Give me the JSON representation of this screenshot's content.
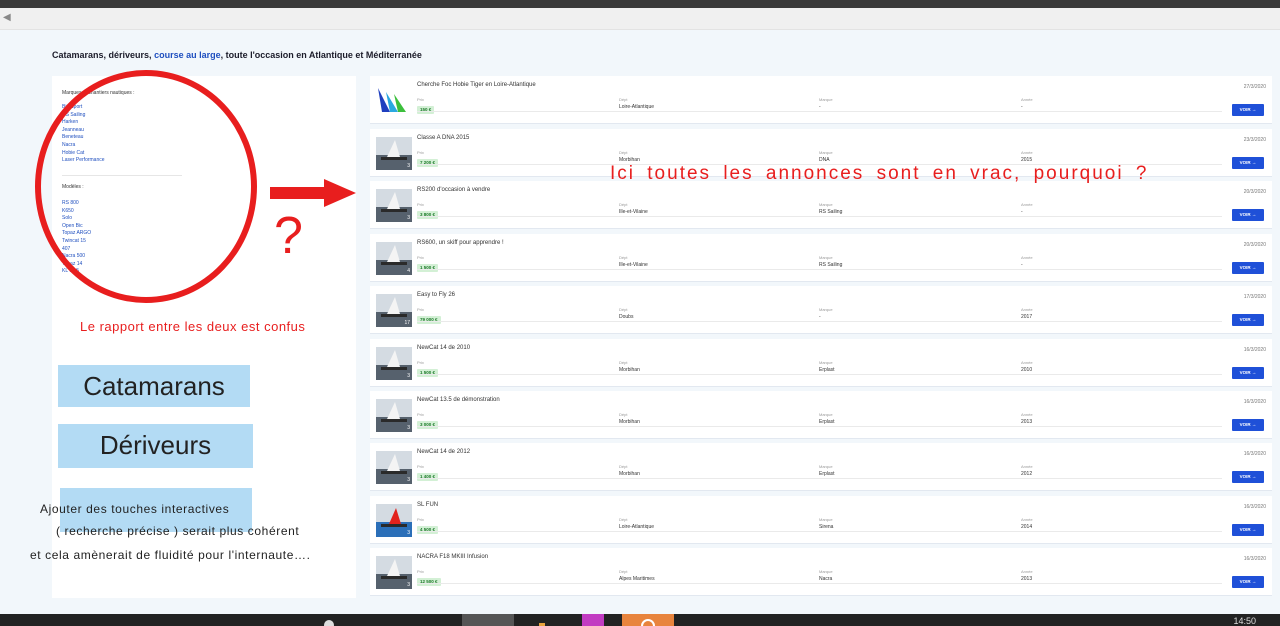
{
  "page": {
    "heading_part1": "Catamarans, dériveurs, ",
    "heading_link": "course au large",
    "heading_part2": ", toute l'occasion en Atlantique et Méditerranée"
  },
  "sidebar": {
    "brands_heading": "Marques et chantiers nautiques :",
    "brands": [
      "Bic Sport",
      "RS Sailing",
      "Harken",
      "Jeanneau",
      "Beneteau",
      "Nacra",
      "Hobie Cat",
      "Laser Performance"
    ],
    "models_heading": "Modèles :",
    "models": [
      "RS 800",
      "K650",
      "Solo",
      "Open Bic",
      "Topaz ARGO",
      "Twincat 15",
      "407",
      "Nacra 500",
      "Topaz 14",
      "KL 15.5"
    ]
  },
  "columns": {
    "price": "Prix",
    "dept": "Dépt",
    "brand": "Marque",
    "year": "Année"
  },
  "voir_label": "VOIR →",
  "listings": [
    {
      "title": "Cherche Foc Hobie Tiger en Loire-Atlantique",
      "price": "150 €",
      "dept": "Loire-Atlantique",
      "brand": "-",
      "year": "-",
      "date": "27/3/2020",
      "photos": ""
    },
    {
      "title": "Classe A DNA 2015",
      "price": "7 200 €",
      "dept": "Morbihan",
      "brand": "DNA",
      "year": "2015",
      "date": "23/3/2020",
      "photos": "3"
    },
    {
      "title": "RS200 d'occasion à vendre",
      "price": "3 800 €",
      "dept": "Ille-et-Vilaine",
      "brand": "RS Sailing",
      "year": "-",
      "date": "20/3/2020",
      "photos": "3"
    },
    {
      "title": "RS600, un skiff pour apprendre !",
      "price": "1 500 €",
      "dept": "Ille-et-Vilaine",
      "brand": "RS Sailing",
      "year": "-",
      "date": "20/3/2020",
      "photos": "4"
    },
    {
      "title": "Easy to Fly 26",
      "price": "79 000 €",
      "dept": "Doubs",
      "brand": "-",
      "year": "2017",
      "date": "17/3/2020",
      "photos": "17"
    },
    {
      "title": "NewCat 14 de 2010",
      "price": "1 500 €",
      "dept": "Morbihan",
      "brand": "Erplast",
      "year": "2010",
      "date": "16/3/2020",
      "photos": "3"
    },
    {
      "title": "NewCat 13.5 de démonstration",
      "price": "3 000 €",
      "dept": "Morbihan",
      "brand": "Erplast",
      "year": "2013",
      "date": "16/3/2020",
      "photos": "3"
    },
    {
      "title": "NewCat 14 de 2012",
      "price": "1 400 €",
      "dept": "Morbihan",
      "brand": "Erplast",
      "year": "2012",
      "date": "16/3/2020",
      "photos": "3"
    },
    {
      "title": "SL FUN",
      "price": "4 500 €",
      "dept": "Loire-Atlantique",
      "brand": "Sirena",
      "year": "2014",
      "date": "16/3/2020",
      "photos": "3"
    },
    {
      "title": "NACRA F18 MKIII Infusion",
      "price": "12 500 €",
      "dept": "Alpes Maritimes",
      "brand": "Nacra",
      "year": "2013",
      "date": "16/3/2020",
      "photos": "3"
    }
  ],
  "annotations": {
    "question_mark": "?",
    "right_note": "Ici toutes les annonces sont en vrac, pourquoi ?",
    "confus_note": "Le rapport entre les deux est confus",
    "button_catamarans": "Catamarans",
    "button_deriveurs": "Dériveurs",
    "suggestion_line1": "Ajouter des touches interactives",
    "suggestion_line2": "( recherche précise ) serait plus cohérent",
    "suggestion_line3": "et cela amènerait de fluidité pour l'internaute…."
  },
  "taskbar": {
    "clock": "14:50"
  },
  "colors": {
    "accent": "#1f50d8",
    "annotation": "#e81e1e",
    "price_badge": "#d3f0d5",
    "mock_button": "#b3dbf4"
  }
}
